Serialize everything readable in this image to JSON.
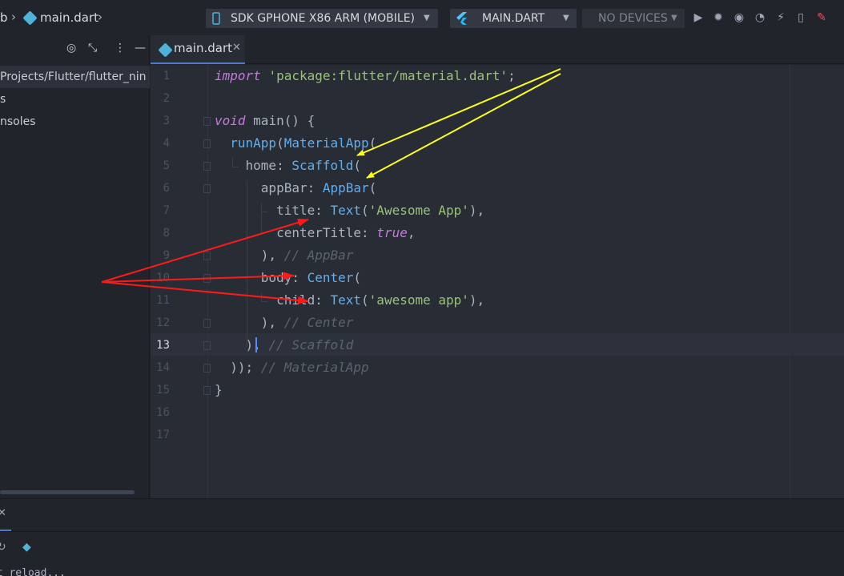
{
  "breadcrumb": {
    "project_fragment": "b",
    "file": "main.dart"
  },
  "toolbar": {
    "device_selector": "SDK GPHONE X86 ARM (MOBILE)",
    "run_config": "MAIN.DART",
    "devices": "NO DEVICES",
    "icons": [
      "run-icon",
      "debug-icon",
      "profile-icon",
      "performance-icon",
      "hot-reload-icon",
      "device-icon",
      "flutter-inspector-icon"
    ]
  },
  "project_panel": {
    "tree": [
      {
        "text": "Projects/Flutter/flutter_nin",
        "selected": true
      },
      {
        "text": "s",
        "selected": false
      },
      {
        "text": "nsoles",
        "selected": false
      }
    ]
  },
  "editor": {
    "tab_label": "main.dart",
    "current_line": 13,
    "line_numbers": [
      "1",
      "2",
      "3",
      "4",
      "5",
      "6",
      "7",
      "8",
      "9",
      "10",
      "11",
      "12",
      "13",
      "14",
      "15",
      "16",
      "17"
    ],
    "code": {
      "l1": {
        "kw": "import",
        "str": "'package:flutter/material.dart'",
        "end": ";"
      },
      "l3": {
        "kw": "void",
        "name": "main",
        "rest": "() {"
      },
      "l4": {
        "fn": "runApp",
        "p": "(",
        "cls": "MaterialApp",
        "open": "("
      },
      "l5": {
        "prop": "home: ",
        "cls": "Scaffold",
        "open": "("
      },
      "l6": {
        "prop": "appBar: ",
        "cls": "AppBar",
        "open": "("
      },
      "l7": {
        "prop": "title: ",
        "cls": "Text",
        "p": "(",
        "str": "'Awesome App'",
        "end": "),"
      },
      "l8": {
        "prop": "centerTitle: ",
        "lit": "true",
        "end": ","
      },
      "l9": {
        "code": "), ",
        "cmt": "// AppBar"
      },
      "l10": {
        "prop": "body: ",
        "cls": "Center",
        "open": "("
      },
      "l11": {
        "prop": "child: ",
        "cls": "Text",
        "p": "(",
        "str": "'awesome app'",
        "end": "),"
      },
      "l12": {
        "code": "), ",
        "cmt": "// Center"
      },
      "l13": {
        "code": "), ",
        "cmt": "// Scaffold"
      },
      "l14": {
        "code": ")); ",
        "cmt": "// MaterialApp"
      },
      "l15": {
        "code": "}"
      }
    }
  },
  "run_panel": {
    "console": "ot reload..."
  },
  "colors": {
    "background": "#21252b",
    "editor_bg": "#282c34",
    "keyword": "#c678dd",
    "string": "#98c379",
    "class": "#61afef",
    "comment": "#5c6370",
    "annotation_yellow": "#ffff1a",
    "annotation_red": "#ff1a1a",
    "accent": "#4d78cc"
  }
}
